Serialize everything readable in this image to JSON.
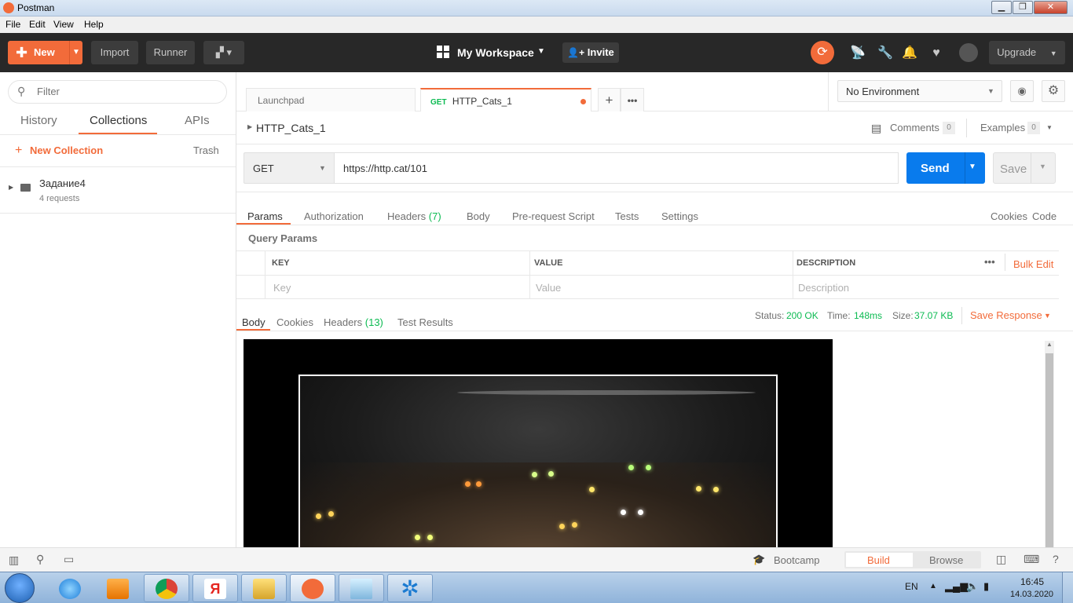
{
  "window": {
    "title": "Postman"
  },
  "menubar": [
    "File",
    "Edit",
    "View",
    "Help"
  ],
  "header": {
    "new_label": "New",
    "import_label": "Import",
    "runner_label": "Runner",
    "workspace_label": "My Workspace",
    "invite_label": "Invite",
    "upgrade_label": "Upgrade"
  },
  "sidebar": {
    "filter_placeholder": "Filter",
    "tabs": [
      "History",
      "Collections",
      "APIs"
    ],
    "new_collection_label": "New Collection",
    "trash_label": "Trash",
    "collections": [
      {
        "name": "Задание4",
        "meta": "4 requests"
      }
    ]
  },
  "tabs": {
    "launchpad": "Launchpad",
    "active_method": "GET",
    "active_name": "HTTP_Cats_1"
  },
  "environment": {
    "selected": "No Environment"
  },
  "request": {
    "breadcrumb": "HTTP_Cats_1",
    "comments_label": "Comments",
    "comments_count": "0",
    "examples_label": "Examples",
    "examples_count": "0",
    "method": "GET",
    "url": "https://http.cat/101",
    "send_label": "Send",
    "save_label": "Save",
    "subtabs": {
      "params": "Params",
      "authorization": "Authorization",
      "headers": "Headers",
      "headers_count": "(7)",
      "body": "Body",
      "prerequest": "Pre-request Script",
      "tests": "Tests",
      "settings": "Settings"
    },
    "cookies_link": "Cookies",
    "code_link": "Code",
    "query_params_title": "Query Params",
    "columns": {
      "key": "KEY",
      "value": "VALUE",
      "description": "DESCRIPTION"
    },
    "bulk_edit": "Bulk Edit",
    "placeholders": {
      "key": "Key",
      "value": "Value",
      "description": "Description"
    }
  },
  "response": {
    "tabs": {
      "body": "Body",
      "cookies": "Cookies",
      "headers": "Headers",
      "headers_count": "(13)",
      "test_results": "Test Results"
    },
    "status_label": "Status:",
    "status_value": "200 OK",
    "time_label": "Time:",
    "time_value": "148ms",
    "size_label": "Size:",
    "size_value": "37.07 KB",
    "save_response": "Save Response"
  },
  "footer": {
    "bootcamp": "Bootcamp",
    "build": "Build",
    "browse": "Browse"
  },
  "taskbar": {
    "lang": "EN",
    "time": "16:45",
    "date": "14.03.2020"
  },
  "colors": {
    "accent": "#f26b3a",
    "send_blue": "#097bed",
    "header_bg": "#282828",
    "status_green": "#0cbb52"
  }
}
